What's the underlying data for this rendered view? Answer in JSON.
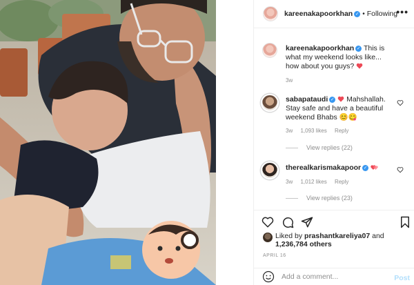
{
  "header": {
    "username": "kareenakapoorkhan",
    "follow_label": "Following",
    "more_label": "•••"
  },
  "caption": {
    "username": "kareenakapoorkhan",
    "text": "This is what my weekend looks like... how about you guys?",
    "time": "3w"
  },
  "comments": [
    {
      "username": "sabapataudi",
      "text": "Mahshallah. Stay safe and have a beautiful weekend Bhabs",
      "emoji_tail": "😊😋",
      "time": "3w",
      "likes": "1,093 likes",
      "reply_label": "Reply",
      "view_replies": "View replies (22)"
    },
    {
      "username": "therealkarismakapoor",
      "text": "",
      "time": "3w",
      "likes": "1,012 likes",
      "reply_label": "Reply",
      "view_replies": "View replies (23)"
    }
  ],
  "likes": {
    "prefix": "Liked by",
    "user": "prashantkareliya07",
    "joiner": "and",
    "others": "1,236,784 others"
  },
  "date": "APRIL 16",
  "add_comment": {
    "placeholder": "Add a comment...",
    "post_label": "Post"
  },
  "colors": {
    "verified": "#3897f0",
    "heart": "#ed4956",
    "muted": "#8e8e8e",
    "post_disabled": "#b2dffc"
  }
}
